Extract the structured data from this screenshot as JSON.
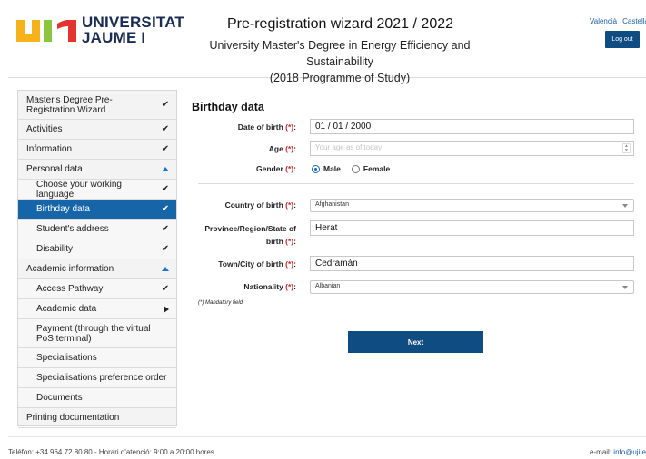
{
  "header": {
    "logo_text_line1": "UNIVERSITAT",
    "logo_text_line2": "JAUME I",
    "title": "Pre-registration wizard 2021 / 2022",
    "subtitle_line1": "University Master's Degree in Energy Efficiency and Sustainability",
    "subtitle_line2": "(2018 Programme of Study)",
    "lang_valencia": "Valencià",
    "lang_castellano": "Castellan",
    "logout_label": "Log out",
    "logo_colors": [
      "#f5b21b",
      "#8cc63f",
      "#e3342f"
    ]
  },
  "sidebar": {
    "items": [
      {
        "label": "Master's Degree Pre-Registration Wizard",
        "mark": "check"
      },
      {
        "label": "Activities",
        "mark": "check"
      },
      {
        "label": "Information",
        "mark": "check"
      },
      {
        "label": "Personal data",
        "mark": "arrow-up"
      },
      {
        "label": "Choose your working language",
        "mark": "check"
      },
      {
        "label": "Birthday data",
        "mark": "check"
      },
      {
        "label": "Student's address",
        "mark": "check"
      },
      {
        "label": "Disability",
        "mark": "check"
      },
      {
        "label": "Academic information",
        "mark": "arrow-up"
      },
      {
        "label": "Access Pathway",
        "mark": "check"
      },
      {
        "label": "Academic data",
        "mark": "arrow-right"
      },
      {
        "label": "Payment (through the virtual PoS terminal)",
        "mark": ""
      },
      {
        "label": "Specialisations",
        "mark": ""
      },
      {
        "label": "Specialisations preference order",
        "mark": ""
      },
      {
        "label": "Documents",
        "mark": ""
      },
      {
        "label": "Printing documentation",
        "mark": ""
      }
    ]
  },
  "form": {
    "section_title": "Birthday data",
    "dob_label": "Date of birth",
    "dob_value": "01 / 01 / 2000",
    "age_label": "Age",
    "age_placeholder": "Your age as of today",
    "gender_label": "Gender",
    "gender_male": "Male",
    "gender_female": "Female",
    "gender_selected": "Male",
    "country_label": "Country of birth",
    "country_value": "Afghanistan",
    "province_label": "Province/Region/State of birth",
    "province_value": "Herat",
    "town_label": "Town/City of birth",
    "town_value": "Cedramán",
    "nationality_label": "Nationality",
    "nationality_value": "Albanian",
    "required_mark": "(*)",
    "colon": ":",
    "mandatory_note": "(*) Mandatory field.",
    "next_label": "Next"
  },
  "footer": {
    "left_text": "Teléfon: +34 964 72 80 80 - Horari d'atenció: 9:00 a 20:00 hores",
    "email_label": "e-mail:",
    "email_value": "info@uji.e"
  }
}
